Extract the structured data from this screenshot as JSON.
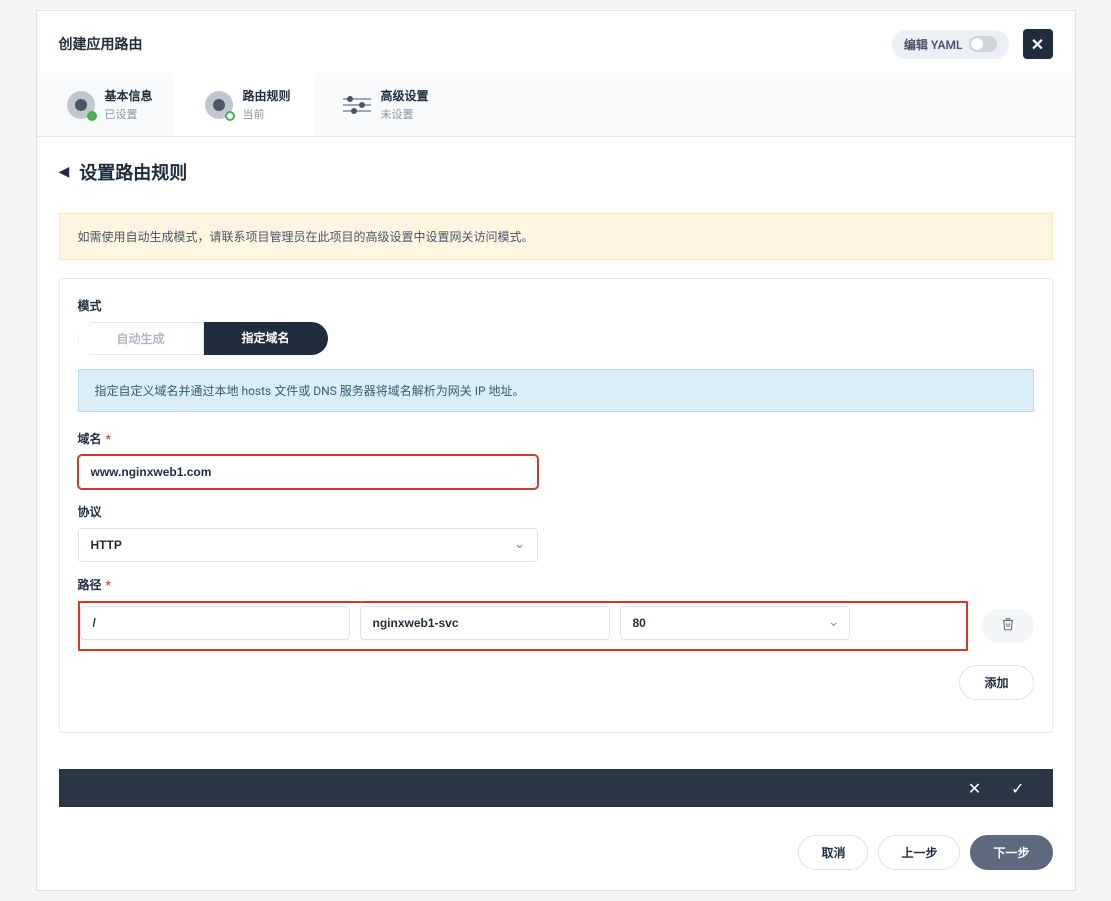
{
  "header": {
    "title": "创建应用路由",
    "yaml_label": "编辑 YAML"
  },
  "steps": {
    "s1": {
      "label": "基本信息",
      "status": "已设置"
    },
    "s2": {
      "label": "路由规则",
      "status": "当前"
    },
    "s3": {
      "label": "高级设置",
      "status": "未设置"
    }
  },
  "section": {
    "title": "设置路由规则"
  },
  "alert": {
    "warn": "如需使用自动生成模式，请联系项目管理员在此项目的高级设置中设置网关访问模式。"
  },
  "mode": {
    "label": "模式",
    "auto": "自动生成",
    "custom": "指定域名"
  },
  "info": "指定自定义域名并通过本地 hosts 文件或 DNS 服务器将域名解析为网关 IP 地址。",
  "domain": {
    "label": "域名",
    "value": "www.nginxweb1.com"
  },
  "protocol": {
    "label": "协议",
    "value": "HTTP"
  },
  "path": {
    "label": "路径",
    "path_value": "/",
    "service_value": "nginxweb1-svc",
    "port_value": "80",
    "add_label": "添加"
  },
  "footer": {
    "cancel": "取消",
    "prev": "上一步",
    "next": "下一步"
  }
}
